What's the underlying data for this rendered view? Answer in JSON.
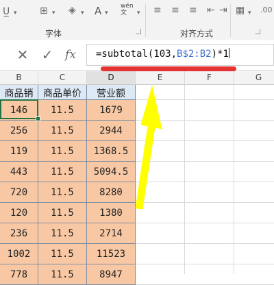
{
  "ribbon": {
    "font_group_label": "字体",
    "align_group_label": "对齐方式",
    "font_color_letter": "A",
    "wen_label": "wén\n文"
  },
  "formula_bar": {
    "cancel_icon": "close-icon",
    "confirm_icon": "check-icon",
    "fx_label": "fx",
    "formula_prefix": "=subtotal(103,",
    "formula_ref": "B$2:B2",
    "formula_suffix": ")*1"
  },
  "columns": {
    "headers": [
      "B",
      "C",
      "D",
      "E",
      "F",
      "G"
    ],
    "selected": "D"
  },
  "table": {
    "headers": [
      "商品销量",
      "商品单价",
      "营业额"
    ],
    "rows": [
      [
        "146",
        "11.5",
        "1679"
      ],
      [
        "256",
        "11.5",
        "2944"
      ],
      [
        "119",
        "11.5",
        "1368.5"
      ],
      [
        "443",
        "11.5",
        "5094.5"
      ],
      [
        "720",
        "11.5",
        "8280"
      ],
      [
        "120",
        "11.5",
        "1380"
      ],
      [
        "236",
        "11.5",
        "2714"
      ],
      [
        "1002",
        "11.5",
        "11523"
      ],
      [
        "778",
        "11.5",
        "8947"
      ]
    ]
  },
  "annotation": {
    "underline_color": "#e53232",
    "arrow_color": "#ffff00"
  },
  "colors": {
    "header_fill": "#dde9f5",
    "data_fill": "#f8c8a5",
    "selection_border": "#217346"
  }
}
